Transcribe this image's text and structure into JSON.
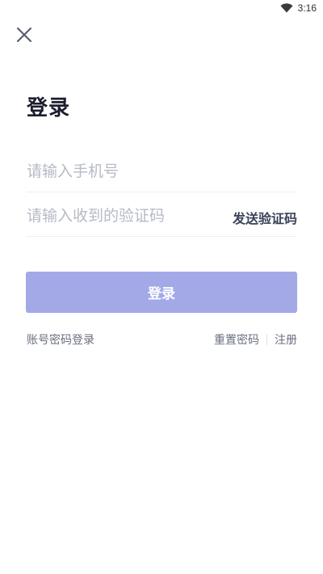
{
  "status_bar": {
    "time": "3:16",
    "wifi_icon": "wifi-icon"
  },
  "header": {
    "close_icon": "close-icon"
  },
  "page": {
    "title": "登录"
  },
  "form": {
    "phone_placeholder": "请输入手机号",
    "phone_value": "",
    "code_placeholder": "请输入收到的验证码",
    "code_value": "",
    "send_code_label": "发送验证码"
  },
  "login_button": {
    "label": "登录",
    "color": "#a3a9e7"
  },
  "links": {
    "password_login": "账号密码登录",
    "reset_password": "重置密码",
    "register": "注册"
  }
}
